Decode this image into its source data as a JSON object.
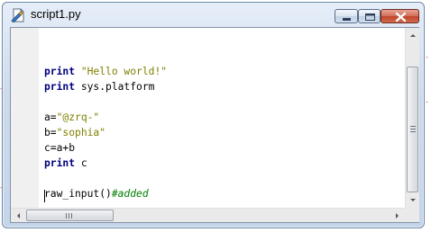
{
  "window": {
    "title": "script1.py",
    "icons": {
      "app": "python-script-icon",
      "minimize": "minimize-icon",
      "maximize": "maximize-icon",
      "close": "close-icon"
    },
    "colors": {
      "keyword": "#00007f",
      "string": "#7f7f00",
      "comment": "#007f00",
      "close_button": "#c2442a"
    }
  },
  "editor": {
    "lines": [
      [],
      [
        {
          "t": "print",
          "c": "kw"
        },
        {
          "t": " "
        },
        {
          "t": "\"Hello world!\"",
          "c": "str"
        }
      ],
      [
        {
          "t": "print",
          "c": "kw"
        },
        {
          "t": " sys.platform"
        }
      ],
      [],
      [
        {
          "t": "a="
        },
        {
          "t": "\"@zrq-\"",
          "c": "str"
        }
      ],
      [
        {
          "t": "b="
        },
        {
          "t": "\"sophia\"",
          "c": "str"
        }
      ],
      [
        {
          "t": "c=a+b"
        }
      ],
      [
        {
          "t": "print",
          "c": "kw"
        },
        {
          "t": " c"
        }
      ],
      [],
      [
        {
          "t": "raw_input()"
        },
        {
          "t": "#added",
          "c": "cm"
        }
      ]
    ]
  }
}
